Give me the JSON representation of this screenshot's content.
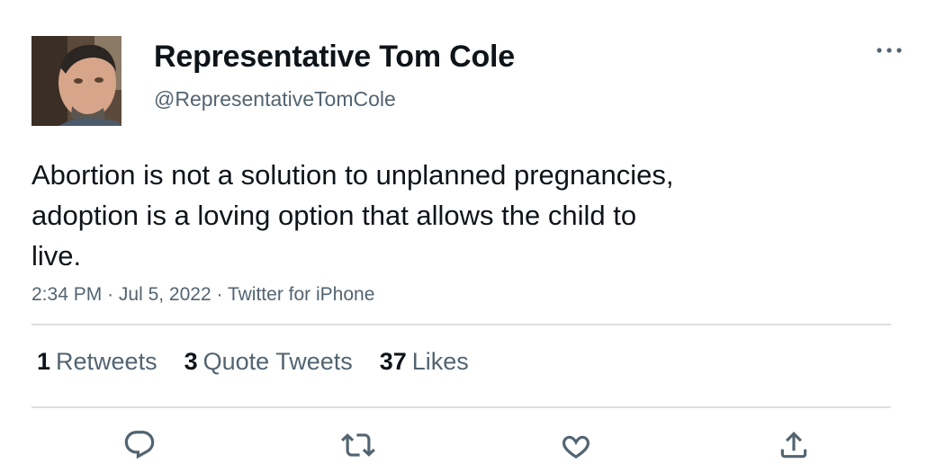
{
  "author": {
    "display_name": "Representative Tom Cole",
    "handle": "@RepresentativeTomCole"
  },
  "tweet": {
    "text": "Abortion is not a solution to unplanned pregnancies,\nadoption is a loving option that allows the child to\nlive.",
    "time": "2:34 PM",
    "separator": "·",
    "date": "Jul 5, 2022",
    "source": "Twitter for iPhone"
  },
  "stats": {
    "retweets_count": "1",
    "retweets_label": "Retweets",
    "quotes_count": "3",
    "quotes_label": "Quote Tweets",
    "likes_count": "37",
    "likes_label": "Likes"
  },
  "icons": {
    "more": "more-icon",
    "reply": "reply-icon",
    "retweet": "retweet-icon",
    "like": "heart-icon",
    "share": "share-icon"
  },
  "colors": {
    "text": "#0f1419",
    "secondary": "#536471",
    "divider": "#dcdfe2",
    "background": "#ffffff"
  }
}
